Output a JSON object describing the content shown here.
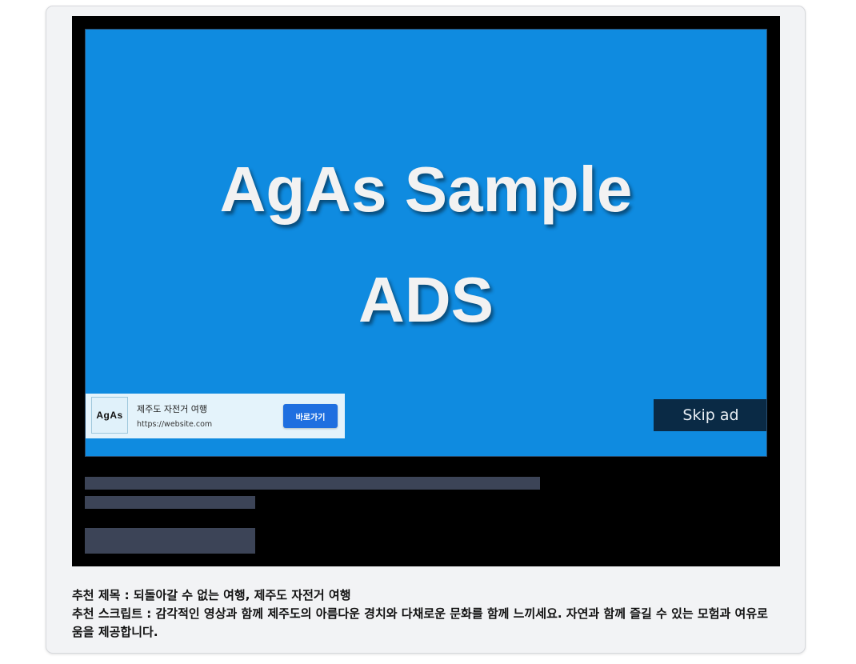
{
  "ad": {
    "title_line1": "AgAs Sample",
    "title_line2": "ADS",
    "background_color": "#0f8be0",
    "banner": {
      "logo_text": "AgAs",
      "title": "제주도 자전거 여행",
      "url": "https://website.com",
      "button_label": "바로가기"
    },
    "skip_label": "Skip ad"
  },
  "recommendation": {
    "title_line": "추천 제목 : 되돌아갈 수 없는 여행, 제주도 자전거 여행",
    "script_line": "추천 스크립트 : 감각적인 영상과 함께 제주도의 아름다운 경치와 다채로운 문화를 함께 느끼세요. 자연과 함께 즐길 수 있는 모험과 여유로움을 제공합니다."
  }
}
